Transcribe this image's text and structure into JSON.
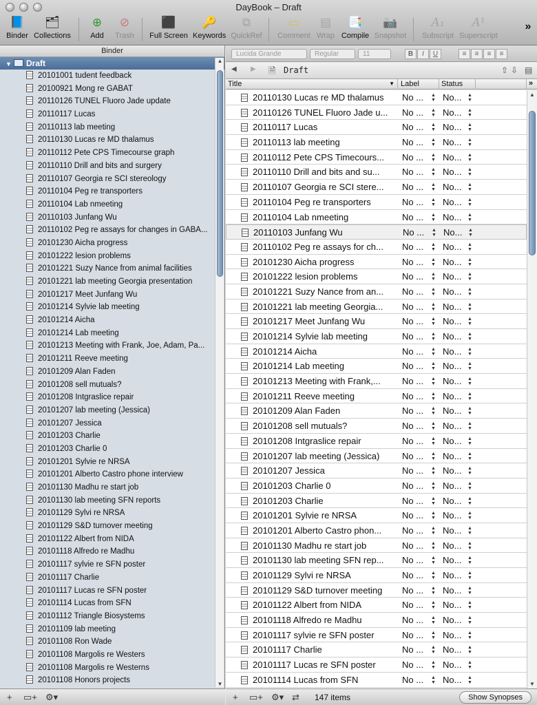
{
  "window": {
    "title": "DayBook – Draft"
  },
  "toolbar": {
    "binder": "Binder",
    "collections": "Collections",
    "add": "Add",
    "trash": "Trash",
    "full_screen": "Full Screen",
    "keywords": "Keywords",
    "quickref": "QuickRef",
    "comment": "Comment",
    "wrap": "Wrap",
    "compile": "Compile",
    "snapshot": "Snapshot",
    "subscript": "Subscript",
    "superscript": "Superscript",
    "overflow": "»"
  },
  "format_bar": {
    "font": "Lucida Grande",
    "style": "Regular",
    "size": "11",
    "bold": "B",
    "italic": "I",
    "underline": "U"
  },
  "binder": {
    "header": "Binder",
    "root": "Draft",
    "items": [
      "20101001 tudent feedback",
      "20100921 Mong re GABAT",
      "20110126 TUNEL Fluoro Jade update",
      "20110117 Lucas",
      "20110113 lab meeting",
      "20110130 Lucas re MD thalamus",
      "20110112 Pete CPS Timecourse graph",
      "20110110 Drill and bits and surgery",
      "20110107 Georgia re SCI stereology",
      "20110104 Peg re transporters",
      "20110104 Lab nmeeting",
      "20110103 Junfang Wu",
      "20110102 Peg re assays for changes in GABA...",
      "20101230 Aicha progress",
      "20101222 lesion problems",
      "20101221 Suzy Nance from animal facilities",
      "20101221 lab meeting Georgia presentation",
      "20101217 Meet Junfang Wu",
      "20101214 Sylvie lab meeting",
      "20101214 Aicha",
      "20101214  Lab meeting",
      "20101213 Meeting with Frank, Joe, Adam, Pa...",
      "20101211 Reeve meeting",
      "20101209  Alan Faden",
      "20101208 sell mutuals?",
      "20101208  Intgraslice repair",
      "20101207 lab meeting (Jessica)",
      "20101207 Jessica",
      "20101203  Charlie",
      "20101203  Charlie 0",
      "20101201 Sylvie re NRSA",
      "20101201 Alberto Castro phone interview",
      "20101130 Madhu re start job",
      "20101130 lab meeting SFN reports",
      "20101129 Sylvi re NRSA",
      "20101129 S&D turnover meeting",
      "20101122  Albert from NIDA",
      "20101118  Alfredo re Madhu",
      "20101117  sylvie re SFN poster",
      "20101117 Charlie",
      "20101117    Lucas re SFN poster",
      "20101114 Lucas from SFN",
      "20101112 Triangle Biosystems",
      "20101109 lab meeting",
      "20101108 Ron Wade",
      "20101108 Margolis re Westers",
      "20101108 Margolis re Westerns",
      "20101108 Honors projects"
    ]
  },
  "editor": {
    "header_title": "Draft"
  },
  "outliner": {
    "columns": {
      "title": "Title",
      "label": "Label",
      "status": "Status"
    },
    "label_value": "No ...",
    "status_value": "No...",
    "rows": [
      "20110130 Lucas re MD thalamus",
      "20110126 TUNEL Fluoro Jade u...",
      "20110117 Lucas",
      "20110113 lab meeting",
      "20110112 Pete CPS Timecours...",
      "20110110 Drill and bits and su...",
      "20110107 Georgia re SCI stere...",
      "20110104 Peg re transporters",
      "20110104 Lab nmeeting",
      "20110103 Junfang Wu",
      "20110102 Peg re assays for ch...",
      "20101230 Aicha progress",
      "20101222 lesion problems",
      "20101221 Suzy Nance from an...",
      "20101221 lab meeting Georgia...",
      "20101217 Meet Junfang Wu",
      "20101214 Sylvie lab meeting",
      "20101214 Aicha",
      "20101214  Lab meeting",
      "20101213 Meeting with Frank,...",
      "20101211 Reeve meeting",
      "20101209  Alan Faden",
      "20101208 sell mutuals?",
      "20101208  Intgraslice repair",
      "20101207 lab meeting (Jessica)",
      "20101207 Jessica",
      "20101203  Charlie 0",
      "20101203  Charlie",
      "20101201 Sylvie re NRSA",
      "20101201 Alberto Castro phon...",
      "20101130 Madhu re start job",
      "20101130 lab meeting SFN rep...",
      "20101129 Sylvi re NRSA",
      "20101129 S&D turnover meeting",
      "20101122  Albert from NIDA",
      "20101118  Alfredo re Madhu",
      "20101117 sylvie re SFN poster",
      "20101117 Charlie",
      "20101117    Lucas re SFN poster",
      "20101114 Lucas from SFN"
    ],
    "highlighted_row": 9
  },
  "footer": {
    "item_count": "147 items",
    "show_synopses": "Show Synopses"
  },
  "colors": {
    "selection_blue": "#4a6c97",
    "binder_bg": "#d6dde5"
  }
}
